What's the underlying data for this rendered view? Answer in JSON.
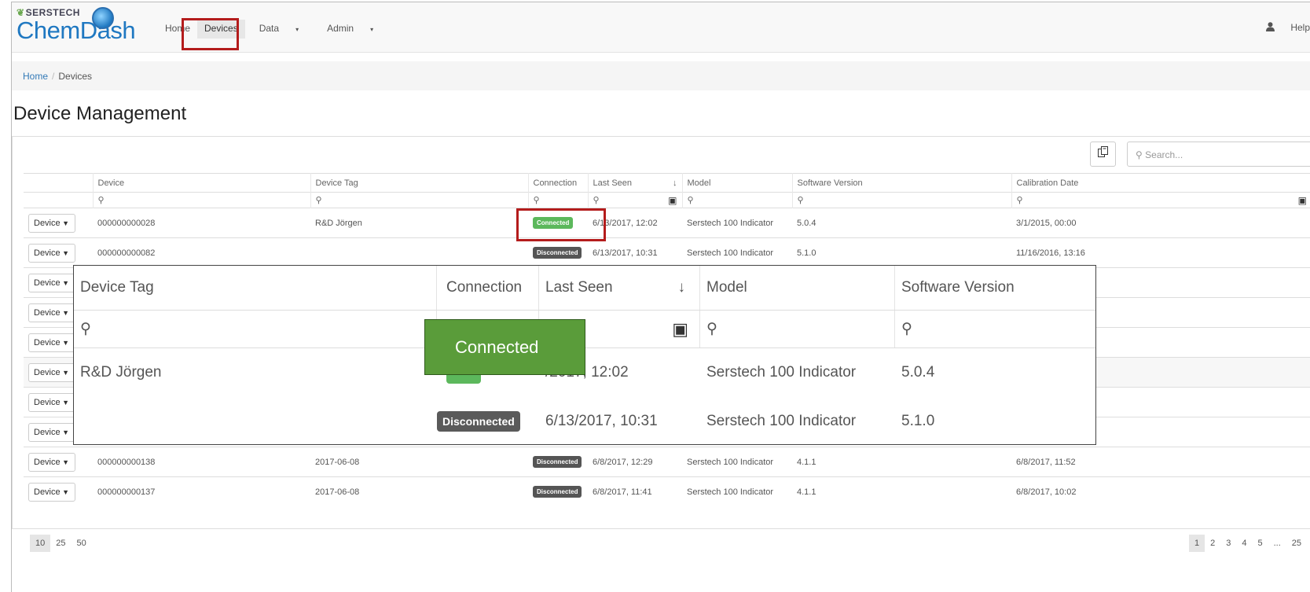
{
  "brand": {
    "company": "SERSTECH",
    "product": "ChemDash"
  },
  "nav": {
    "home": "Home",
    "devices": "Devices",
    "data": "Data",
    "admin": "Admin",
    "help": "Help",
    "caret": "▾"
  },
  "breadcrumb": {
    "home": "Home",
    "separator": "/",
    "current": "Devices"
  },
  "page_title": "Device Management",
  "search": {
    "placeholder": "Search..."
  },
  "table": {
    "columns": [
      "Device",
      "Device Tag",
      "Connection",
      "Last Seen",
      "Model",
      "Software Version",
      "Calibration Date"
    ],
    "sort_arrow": "↓",
    "action_label": "Device",
    "rows": [
      {
        "device": "000000000028",
        "tag": "R&D Jörgen",
        "connection": "Connected",
        "last_seen": "6/13/2017, 12:02",
        "model": "Serstech 100 Indicator",
        "software": "5.0.4",
        "calibration": "3/1/2015, 00:00"
      },
      {
        "device": "000000000082",
        "tag": "",
        "connection": "Disconnected",
        "last_seen": "6/13/2017, 10:31",
        "model": "Serstech 100 Indicator",
        "software": "5.1.0",
        "calibration": "11/16/2016, 13:16"
      },
      {
        "device": "",
        "tag": "",
        "connection": "",
        "last_seen": "",
        "model": "",
        "software": "",
        "calibration": ""
      },
      {
        "device": "",
        "tag": "",
        "connection": "",
        "last_seen": "",
        "model": "",
        "software": "",
        "calibration": ""
      },
      {
        "device": "",
        "tag": "",
        "connection": "",
        "last_seen": "",
        "model": "",
        "software": "",
        "calibration": ""
      },
      {
        "device": "",
        "tag": "",
        "connection": "",
        "last_seen": "",
        "model": "",
        "software": "",
        "calibration": ""
      },
      {
        "device": "",
        "tag": "",
        "connection": "",
        "last_seen": "",
        "model": "",
        "software": "",
        "calibration": ""
      },
      {
        "device": "",
        "tag": "",
        "connection": "",
        "last_seen": "",
        "model": "",
        "software": "",
        "calibration": ""
      },
      {
        "device": "000000000138",
        "tag": "2017-06-08",
        "connection": "Disconnected",
        "last_seen": "6/8/2017, 12:29",
        "model": "Serstech 100 Indicator",
        "software": "4.1.1",
        "calibration": "6/8/2017, 11:52"
      },
      {
        "device": "000000000137",
        "tag": "2017-06-08",
        "connection": "Disconnected",
        "last_seen": "6/8/2017, 11:41",
        "model": "Serstech 100 Indicator",
        "software": "4.1.1",
        "calibration": "6/8/2017, 10:02"
      }
    ]
  },
  "page_size": {
    "options": [
      "10",
      "25",
      "50"
    ],
    "selected": "10"
  },
  "pagination": {
    "pages": [
      "1",
      "2",
      "3",
      "4",
      "5",
      "...",
      "25"
    ],
    "current": "1"
  },
  "zoom": {
    "columns": [
      "Device Tag",
      "Connection",
      "Last Seen",
      "Model",
      "Software Version"
    ],
    "rows": [
      {
        "tag": "R&D Jörgen",
        "last_seen": "/2017, 12:02",
        "model": "Serstech 100 Indicator",
        "software": "5.0.4"
      },
      {
        "tag": "",
        "connection": "Disconnected",
        "last_seen": "6/13/2017, 10:31",
        "model": "Serstech 100 Indicator",
        "software": "5.1.0"
      }
    ]
  },
  "callout": {
    "text": "Connected"
  },
  "colors": {
    "connected": "#5cb85c",
    "disconnected": "#555555",
    "highlight": "#b41c1c",
    "callout": "#5a9c3a",
    "link": "#337ab7"
  }
}
